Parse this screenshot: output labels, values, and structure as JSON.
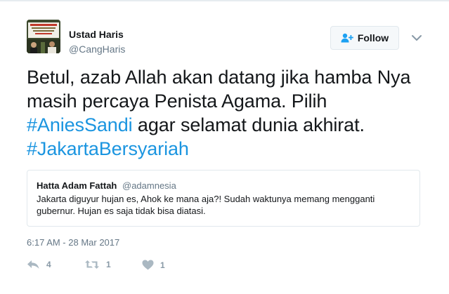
{
  "user": {
    "display_name": "Ustad Haris",
    "screen_name": "@CangHaris",
    "avatar_icon": "event-banner-avatar"
  },
  "follow": {
    "label": "Follow",
    "icon": "person-add-icon"
  },
  "menu": {
    "icon": "chevron-down-icon"
  },
  "tweet": {
    "line1": "Betul, azab Allah akan datang jika hamba Nya",
    "line2": "masih percaya Penista Agama. Pilih",
    "hashtag1": "#AniesSandi",
    "line3_rest": " agar selamat dunia akhirat.",
    "hashtag2": "#JakartaBersyariah"
  },
  "quote": {
    "name": "Hatta Adam Fattah",
    "handle": "@adamnesia",
    "text_line1": "Jakarta diguyur hujan es, Ahok ke mana aja?! Sudah waktunya memang mengganti",
    "text_line2": "gubernur. Hujan es saja tidak bisa diatasi."
  },
  "timestamp": "6:17 AM - 28 Mar 2017",
  "actions": {
    "reply_count": "4",
    "retweet_count": "1",
    "like_count": "1"
  },
  "colors": {
    "link": "#1b95e0",
    "secondary": "#657786",
    "action": "#8899a6"
  }
}
